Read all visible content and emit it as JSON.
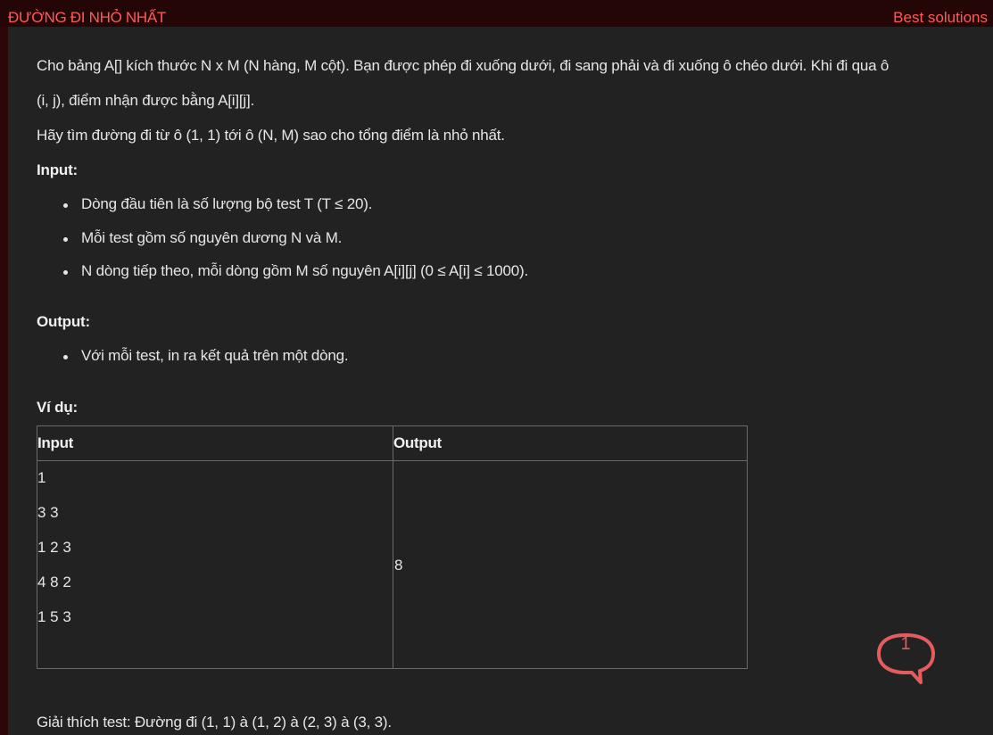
{
  "header": {
    "title": "ĐƯỜNG ĐI NHỎ NHẤT",
    "best_solutions_link": "Best solutions"
  },
  "problem": {
    "statement_line1": "Cho bảng A[] kích thước N x M (N hàng, M cột). Bạn được phép đi xuống dưới, đi sang phải và đi xuống ô chéo dưới. Khi đi qua ô",
    "statement_line2": "(i, j), điểm nhận được bằng A[i][j].",
    "task": "Hãy tìm đường đi từ ô (1, 1) tới ô (N, M) sao cho tổng điểm là nhỏ nhất.",
    "input_heading": "Input:",
    "input_items": [
      "Dòng đầu tiên là số lượng bộ test T (T ≤ 20).",
      "Mỗi test gồm số nguyên dương N và M.",
      "N dòng tiếp theo, mỗi dòng gồm M số nguyên A[i][j] (0 ≤ A[i] ≤ 1000)."
    ],
    "output_heading": "Output:",
    "output_items": [
      "Với mỗi test, in ra kết quả trên một dòng."
    ],
    "example_heading": "Ví dụ:",
    "example_table": {
      "headers": [
        "Input",
        "Output"
      ],
      "input_lines": [
        "1",
        "3 3",
        "1 2 3",
        "4 8 2",
        "1 5 3"
      ],
      "output_value": "8"
    },
    "explanation": "Giải thích test: Đường đi (1, 1) à (1, 2) à (2, 3) à (3, 3)."
  },
  "comments": {
    "count": "1",
    "icon": "speech-bubble-icon",
    "color": "#e55c5c"
  },
  "colors": {
    "title_red": "#ff5a5a",
    "panel_bg": "#222222",
    "frame_bg": "#2b0707"
  }
}
